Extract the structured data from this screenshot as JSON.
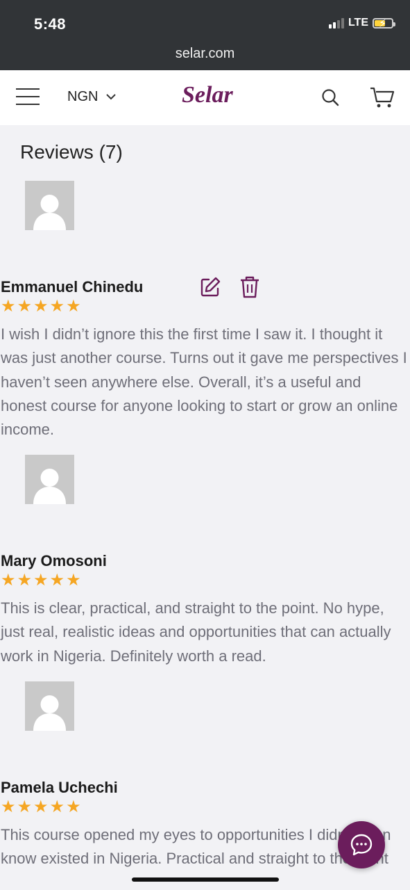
{
  "status_bar": {
    "time": "5:48",
    "network": "LTE",
    "signal_bars_active": 2,
    "signal_bars_total": 4,
    "battery_level": 0.7
  },
  "browser": {
    "url": "selar.com"
  },
  "header": {
    "currency": "NGN",
    "logo": "Selar"
  },
  "reviews": {
    "title": "Reviews (7)",
    "items": [
      {
        "name": "Emmanuel Chinedu",
        "rating": 5,
        "text": "I wish I didn’t ignore this the first time I saw it. I thought it was just another course. Turns out it gave me perspectives I haven’t seen anywhere else. Overall, it’s a useful and honest course for anyone looking to start or grow an online income."
      },
      {
        "name": "Mary Omosoni",
        "rating": 5,
        "text": "This is clear, practical, and straight to the point. No hype, just real, realistic ideas and opportunities that can actually work in Nigeria. Definitely worth a read."
      },
      {
        "name": "Pamela Uchechi",
        "rating": 5,
        "text": "This course opened my eyes to opportunities I didn’t even know existed in Nigeria. Practical and straight to the point"
      }
    ]
  },
  "colors": {
    "brand": "#6b1d5c",
    "star": "#f5a623",
    "chrome": "#313437"
  },
  "icons": [
    "hamburger-icon",
    "chevron-down-icon",
    "search-icon",
    "cart-icon",
    "edit-icon",
    "trash-icon",
    "chat-icon",
    "user-avatar-icon"
  ]
}
